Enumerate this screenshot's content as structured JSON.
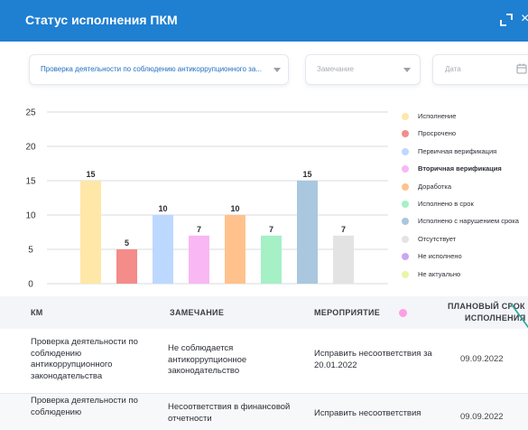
{
  "header": {
    "title": "Статус исполнения ПКМ"
  },
  "filters": {
    "program": "Проверка деятельности по соблюдению антикоррупционного за...",
    "remark_placeholder": "Замечание",
    "date_placeholder": "Дата"
  },
  "chart_data": {
    "type": "bar",
    "categories": [
      "Исполнение",
      "Просрочено",
      "Первичная верификация",
      "Вторичная верификация",
      "Доработка",
      "Исполнено в срок",
      "Исполнено с нарушением срока",
      "Отсутствует"
    ],
    "values": [
      15,
      5,
      10,
      7,
      10,
      7,
      15,
      7
    ],
    "colors": [
      "#ffe7a8",
      "#f48c8a",
      "#bdd8ff",
      "#f9b7f4",
      "#ffc28c",
      "#a6f0c6",
      "#a9c7de",
      "#e3e3e3"
    ],
    "yticks": [
      "0",
      "5",
      "10",
      "15",
      "20",
      "25"
    ],
    "ylim": [
      0,
      25
    ],
    "grid": true,
    "legend_position": "right"
  },
  "legend": [
    {
      "label": "Исполнение",
      "color": "#ffe7a8",
      "bold": false
    },
    {
      "label": "Просрочено",
      "color": "#f48c8a",
      "bold": false
    },
    {
      "label": "Первичная верификация",
      "color": "#bdd8ff",
      "bold": false
    },
    {
      "label": "Вторичная верификация",
      "color": "#f9b7f4",
      "bold": true
    },
    {
      "label": "Доработка",
      "color": "#ffc28c",
      "bold": false
    },
    {
      "label": "Исполнено в срок",
      "color": "#a6f0c6",
      "bold": false
    },
    {
      "label": "Исполнено с нарушением срока",
      "color": "#a9c7de",
      "bold": false
    },
    {
      "label": "Отсутствует",
      "color": "#e3e3e3",
      "bold": false
    },
    {
      "label": "Не исполнено",
      "color": "#c9a6f5",
      "bold": false
    },
    {
      "label": "Не актуально",
      "color": "#e6f7a6",
      "bold": false
    }
  ],
  "table": {
    "headers": {
      "km": "КМ",
      "remark": "ЗАМЕЧАНИЕ",
      "action": "МЕРОПРИЯТИЕ",
      "deadline_line1": "ПЛАНОВЫЙ СРОК",
      "deadline_line2": "ИСПОЛНЕНИЯ"
    },
    "rows": [
      {
        "km": "Проверка деятельности по соблюдению антикоррупционного законодательства",
        "remark": "Не соблюдается антикоррупционное законодательство",
        "action": "Исправить несоответствия за 20.01.2022",
        "date": "09.09.2022"
      },
      {
        "km": "Проверка деятельности по соблюдению",
        "remark": "Несоответствия в финансовой отчетности",
        "action": "Исправить несоответствия",
        "date": "09.09.2022"
      }
    ]
  }
}
